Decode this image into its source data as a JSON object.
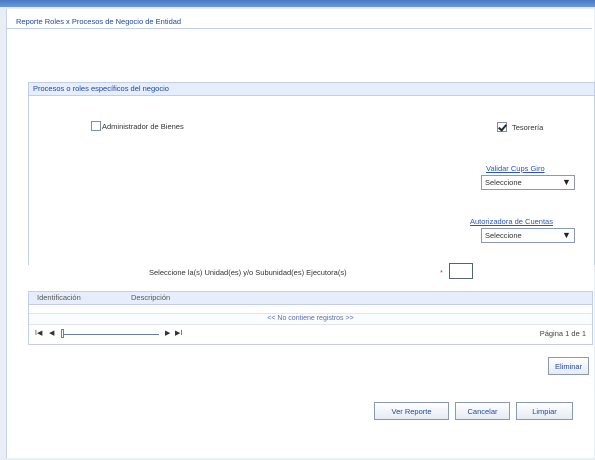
{
  "page": {
    "title": "Reporte Roles x Procesos de Negocio de Entidad"
  },
  "section": {
    "header": "Procesos o roles específicos del negocio",
    "administrador_label": "Administrador de Bienes",
    "administrador_checked": false,
    "tesoreria_label": "Tesorería",
    "tesoreria_checked": true,
    "validar_label": "Validar Cups Giro",
    "validar_value": "Seleccione",
    "autorizadora_label": "Autorizadora de Cuentas",
    "autorizadora_value": "Seleccione",
    "unidades_label": "Seleccione la(s) Unidad(es) y/o Subunidad(es) Ejecutora(s)",
    "required_mark": "*"
  },
  "grid": {
    "columns": [
      "Identificación",
      "Descripción"
    ],
    "empty_text": "<< No contiene registros >>",
    "pager_text": "Página 1 de 1",
    "nav": {
      "first": "I◀",
      "prev": "◀",
      "next": "▶",
      "last": "▶I"
    }
  },
  "buttons": {
    "eliminar": "Eliminar",
    "ver_reporte": "Ver Reporte",
    "cancelar": "Cancelar",
    "limpiar": "Limpiar"
  },
  "icons": {
    "dropdown": "chevron-down-icon",
    "check": "checkmark-icon"
  }
}
